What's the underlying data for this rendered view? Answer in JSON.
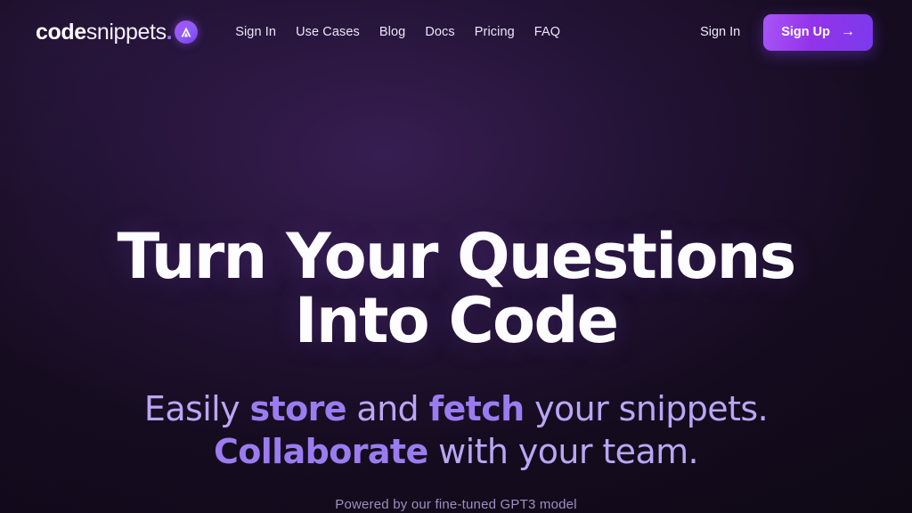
{
  "brand": {
    "bold": "code",
    "light": "snippets",
    "dot": ".",
    "mark_icon": "triangle-a-logo-icon"
  },
  "nav": {
    "items": [
      {
        "label": "Sign In"
      },
      {
        "label": "Use Cases"
      },
      {
        "label": "Blog"
      },
      {
        "label": "Docs"
      },
      {
        "label": "Pricing"
      },
      {
        "label": "FAQ"
      }
    ]
  },
  "header_actions": {
    "signin_label": "Sign In",
    "signup_label": "Sign Up",
    "signup_arrow": "→"
  },
  "hero": {
    "title": "Turn Your Questions Into Code",
    "sub_part1": "Easily ",
    "sub_bold1": "store",
    "sub_part2": " and ",
    "sub_bold2": "fetch",
    "sub_part3": " your snippets.",
    "sub_bold3": "Collaborate",
    "sub_part4": " with your team.",
    "note": "Powered by our fine-tuned GPT3 model"
  },
  "colors": {
    "accent": "#8b5cf6",
    "accent_light": "#a855f7",
    "background": "#170d21",
    "heading": "#fdfcff",
    "sub_text": "#b9a6f5",
    "sub_bold": "#9b7cf0"
  }
}
